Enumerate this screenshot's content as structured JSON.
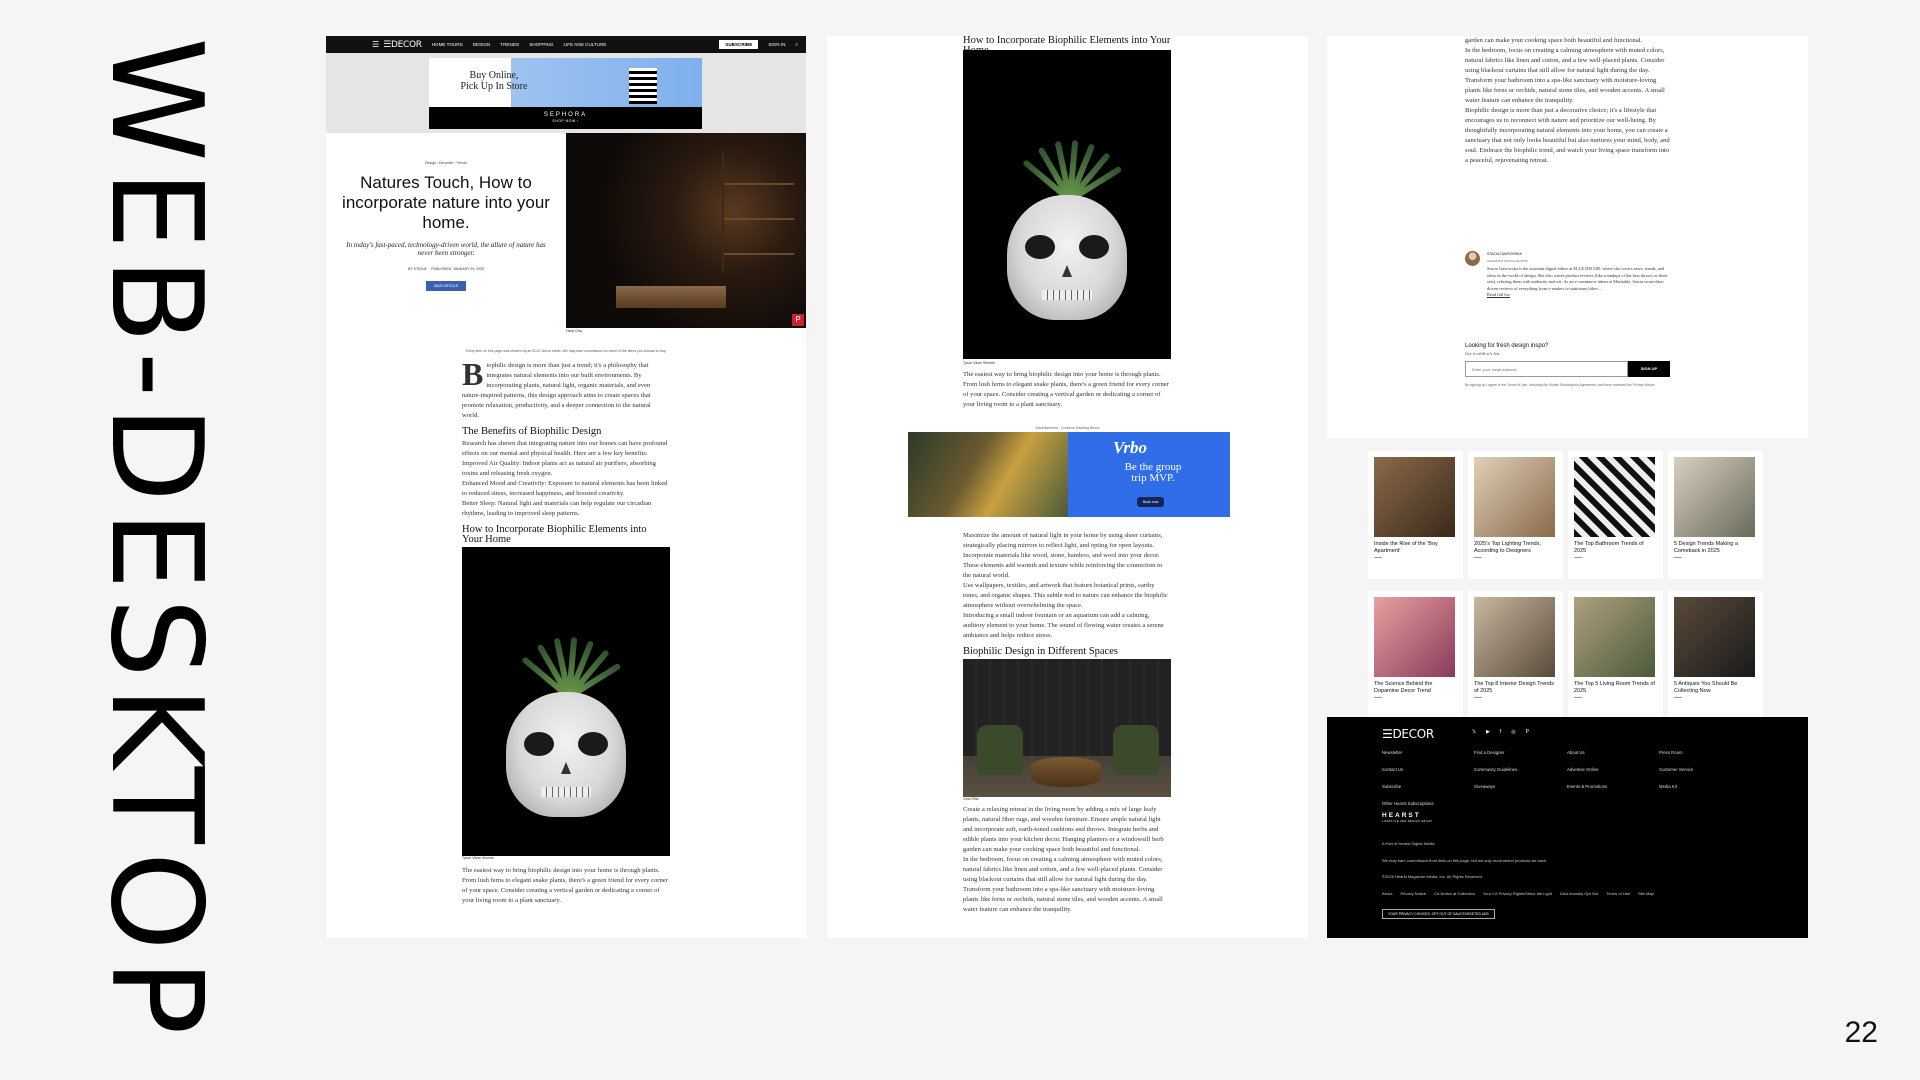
{
  "slide": {
    "title": "WEB-DESKTOP",
    "page_number": "22"
  },
  "site": {
    "logo": "ELLEDECOR",
    "logo_display": "☰DECOR"
  },
  "nav": {
    "items": [
      "HOME TOURS",
      "DESIGN",
      "TRENDS",
      "SHOPPING",
      "LIFE AND CULTURE"
    ],
    "subscribe": "SUBSCRIBE",
    "sign_in": "SIGN IN"
  },
  "ads": {
    "sephora": {
      "headline_1": "Buy Online,",
      "headline_2": "Pick Up In Store",
      "brand": "SEPHORA",
      "cta": "SHOP NOW ›"
    },
    "label": "Advertisement - Continue Reading Below",
    "vrbo": {
      "logo": "Vrbo",
      "tagline_1": "Be the group",
      "tagline_2": "trip MVP.",
      "cta": "Book now"
    }
  },
  "article": {
    "breadcrumb": "Design ›  Decorate ›  Trends",
    "title": "Natures Touch, How to incorporate nature into your home.",
    "dek": "In today's fast-paced, technology-driven world, the allure of nature has never been stronger.",
    "byline": "BY STEA M.",
    "published": "PUBLISHED: JANUARY 29, 2025",
    "save": "SAVE ARTICLE",
    "hero_caption": "Hank Clay",
    "disclaimer": "Every item on this page was chosen by an ELLE Decor editor. We may earn commission on some of the items you choose to buy.",
    "intro_cap": "B",
    "intro": "iophilic design is more than just a trend; it's a philosophy that integrates natural elements into our built environments. By incorporating plants, natural light, organic materials, and even nature-inspired patterns, this design approach aims to create spaces that promote relaxation, productivity, and a deeper connection to the natural world.",
    "h_benefits": "The Benefits of Biophilic Design",
    "benefits": "Research has shown that integrating nature into our homes can have profound effects on our mental and physical health. Here are a few key benefits:",
    "benefit_1": "Improved Air Quality: Indoor plants act as natural air purifiers, absorbing toxins and releasing fresh oxygen.",
    "benefit_2": "Enhanced Mood and Creativity: Exposure to natural elements has been linked to reduced stress, increased happiness, and boosted creativity.",
    "benefit_3": "Better Sleep: Natural light and materials can help regulate our circadian rhythms, leading to improved sleep patterns.",
    "h_incorporate": "How to Incorporate Biophilic Elements into Your Home",
    "plant_caption": "Tyson Vikan Smeets",
    "plant_para": "The easiest way to bring biophilic design into your home is through plants. From lush ferns to elegant snake plants, there's a green friend for every corner of your space. Consider creating a vertical garden or dedicating a corner of your living room to a plant sanctuary.",
    "light_para": "Maximize the amount of natural light in your home by using sheer curtains, strategically placing mirrors to reflect light, and opting for open layouts.",
    "materials_para": "Incorporate materials like wood, stone, bamboo, and wool into your decor. These elements add warmth and texture while reinforcing the connection to the natural world.",
    "patterns_para": "Use wallpapers, textiles, and artwork that feature botanical prints, earthy tones, and organic shapes. This subtle nod to nature can enhance the biophilic atmosphere without overwhelming the space.",
    "water_para": "Introducing a small indoor fountain or an aquarium can add a calming, auditory element to your home. The sound of flowing water creates a serene ambiance and helps reduce stress.",
    "h_spaces": "Biophilic Design in Different Spaces",
    "room_caption": "Jona Rifts",
    "living_para": "Create a relaxing retreat in the living room by adding a mix of large leafy plants, natural fiber rugs, and wooden furniture. Ensure ample natural light and incorporate soft, earth-toned cushions and throws. Integrate herbs and edible plants into your kitchen decor. Hanging planters or a windowsill herb garden can make your cooking space both beautiful and functional.",
    "bedroom_para": "In the bedroom, focus on creating a calming atmosphere with muted colors, natural fabrics like linen and cotton, and a few well-placed plants. Consider using blackout curtains that still allow for natural light during the day.",
    "bathroom_para": "Transform your bathroom into a spa-like sanctuary with moisture-loving plants like ferns or orchids, natural stone tiles, and wooden accents. A small water feature can enhance the tranquility.",
    "closing_para": "Biophilic design is more than just a decorative choice; it's a lifestyle that encourages us to reconnect with nature and prioritize our well-being. By thoughtfully incorporating natural elements into your home, you can create a sanctuary that not only looks beautiful but also nurtures your mind, body, and soul. Embrace the biophilic trend, and watch your living space transform into a peaceful, rejuvenating retreat."
  },
  "author": {
    "name": "STACIA GAVROVSKA",
    "role": "ASSISTANT DIGITAL EDITOR",
    "bio": "Stacia Gavrovska is the assistant digital editor at ELLE DECOR, where she covers news, trends, and ideas in the world of design. She also writes product reviews (like roundups of the best throws or sheet sets), refusing them with authority and wit. As an e-commerce intern at Mashable, Stacia wrote data-driven reviews of everything from e-readers to stationary bikes ...",
    "read_more": "Read full bio"
  },
  "newsletter": {
    "heading": "Looking for fresh design inspo?",
    "subheading": "Get it while it's hot.",
    "placeholder": "Enter your email address",
    "button": "SIGN UP",
    "legal": "By signing up I agree to the Terms of Use, including the Mobile Subscription Agreement, and have reviewed the Privacy Notice."
  },
  "related": [
    {
      "title": "Inside the Rise of the 'Boy Apartment'",
      "color": "#6a4a30"
    },
    {
      "title": "2025's Top Lighting Trends, According to Designers",
      "color": "#c8b090"
    },
    {
      "title": "The Top Bathroom Trends of 2025",
      "color": "#2a2a2a"
    },
    {
      "title": "5 Design Trends Making a Comeback in 2025",
      "color": "#9a8a70"
    },
    {
      "title": "The Science Behind the Dopamine Decor Trend",
      "color": "#c06a6a"
    },
    {
      "title": "The Top 8 Interior Design Trends of 2025",
      "color": "#8a7a60"
    },
    {
      "title": "The Top 5 Living Room Trends of 2025",
      "color": "#7a6a50"
    },
    {
      "title": "5 Antiques You Should Be Collecting Now",
      "color": "#4a3a2a"
    }
  ],
  "footer": {
    "social": [
      "𝕏",
      "▶",
      "f",
      "◎",
      "P"
    ],
    "col1": [
      "Newsletter",
      "Contact Us",
      "Subscribe",
      "Other Hearst Subscriptions"
    ],
    "col2": [
      "Find a Designer",
      "Community Guidelines",
      "Giveaways"
    ],
    "col3": [
      "About Us",
      "Advertise Online",
      "Events & Promotions"
    ],
    "col4": [
      "Press Room",
      "Customer Service",
      "Media Kit"
    ],
    "hearst": "HEARST",
    "hearst_sub": "LIFESTYLE AND DESIGN GROUP",
    "part_of": "A Part of Hearst Digital Media",
    "commission": "We may earn commission from links on this page, but we only recommend products we back.",
    "copyright": "©2025 Hearst Magazine Media, Inc. All Rights Reserved.",
    "bottom_links": [
      "About",
      "Privacy Notice",
      "CA Notice at Collection",
      "Your CA Privacy Rights/Shine the Light",
      "DAA Industry Opt Out",
      "Terms of Use",
      "Site Map"
    ],
    "privacy_choice": "YOUR PRIVACY CHOICES: OPT OUT OF SALE/TARGETED ADS"
  }
}
